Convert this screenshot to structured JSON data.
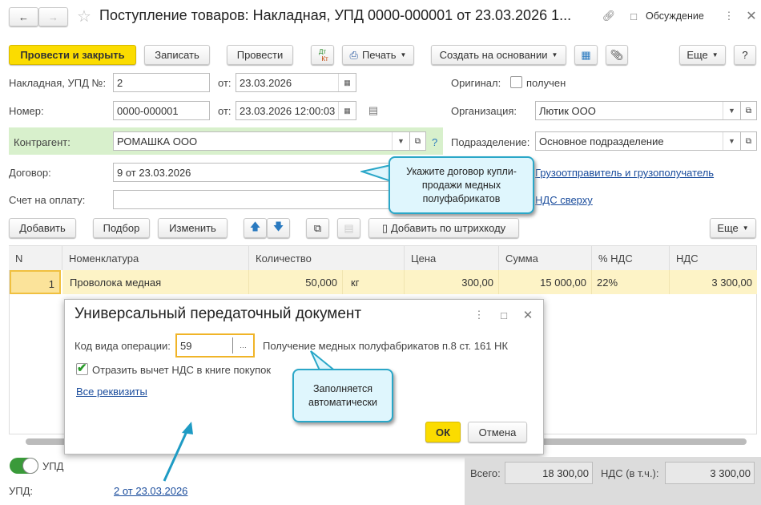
{
  "window": {
    "title": "Поступление товаров: Накладная, УПД 0000-000001 от 23.03.2026 1...",
    "discussion": "Обсуждение"
  },
  "toolbar": {
    "post_close": "Провести и закрыть",
    "save": "Записать",
    "post": "Провести",
    "dtkt_top": "Дт",
    "dtkt_bottom": "Кт",
    "print": "Печать",
    "create_based": "Создать на основании",
    "more": "Еще",
    "help": "?"
  },
  "form": {
    "invoice_label": "Накладная, УПД №:",
    "invoice_value": "2",
    "from_label": "от:",
    "invoice_date": "23.03.2026",
    "original_label": "Оригинал:",
    "original_received": "получен",
    "number_label": "Номер:",
    "number_value": "0000-000001",
    "number_date": "23.03.2026 12:00:03",
    "org_label": "Организация:",
    "org_value": "Лютик ООО",
    "counterparty_label": "Контрагент:",
    "counterparty_value": "РОМАШКА ООО",
    "help": "?",
    "division_label": "Подразделение:",
    "division_value": "Основное подразделение",
    "contract_label": "Договор:",
    "contract_value": "9 от 23.03.2026",
    "shipper_link": "Грузоотправитель и грузополучатель",
    "payment_label": "Счет на оплату:",
    "payment_value": "",
    "vat_link": "НДС сверху"
  },
  "callouts": {
    "contract": "Укажите договор купли-продажи медных полуфабрикатов",
    "auto": "Заполняется автоматически"
  },
  "table_toolbar": {
    "add": "Добавить",
    "pick": "Подбор",
    "edit": "Изменить",
    "barcode": "Добавить по штрихкоду",
    "more": "Еще"
  },
  "table": {
    "columns": [
      "N",
      "Номенклатура",
      "Количество",
      "Цена",
      "Сумма",
      "% НДС",
      "НДС"
    ],
    "rows": [
      {
        "n": "1",
        "item": "Проволока медная",
        "qty": "50,000",
        "unit": "кг",
        "price": "300,00",
        "sum": "15 000,00",
        "vat_rate": "22%",
        "vat": "3 300,00"
      }
    ]
  },
  "dialog": {
    "title": "Универсальный передаточный документ",
    "op_code_label": "Код вида операции:",
    "op_code_value": "59",
    "op_code_desc": "Получение медных полуфабрикатов п.8 ст. 161 НК",
    "reflect_vat": "Отразить вычет НДС в книге покупок",
    "reflect_vat_checked": true,
    "all_props": "Все реквизиты",
    "ok": "ОК",
    "cancel": "Отмена"
  },
  "footer": {
    "upd_toggle": "УПД",
    "upd_toggle_on": true,
    "upd_label": "УПД:",
    "upd_link": "2 от 23.03.2026",
    "total_label": "Всего:",
    "total_value": "18 300,00",
    "vat_label": "НДС (в т.ч.):",
    "vat_value": "3 300,00"
  },
  "colors": {
    "accent": "#fbdc00",
    "link": "#1a4c9c",
    "callout_border": "#2aa7c8",
    "row_selected": "#fdf3c6",
    "counterparty_bg": "#d8f0cc",
    "toggle": "#3a9a3a"
  }
}
